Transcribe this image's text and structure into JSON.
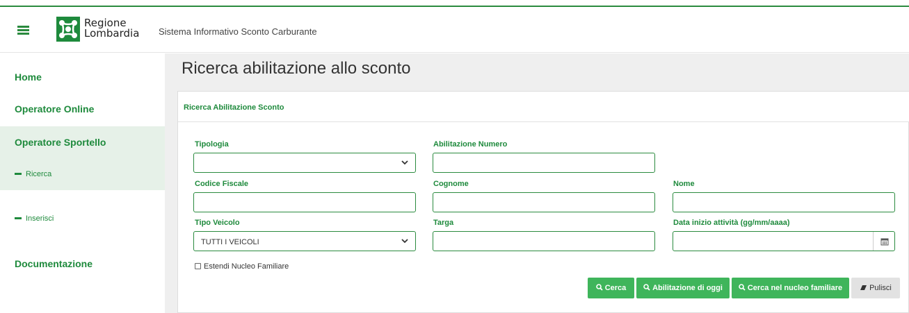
{
  "header": {
    "logo_line1": "Regione",
    "logo_line2": "Lombardia",
    "app_title": "Sistema Informativo Sconto Carburante"
  },
  "sidebar": {
    "home": "Home",
    "operatore_online": "Operatore Online",
    "operatore_sportello": "Operatore Sportello",
    "sub_ricerca": "Ricerca",
    "sub_inserisci": "Inserisci",
    "documentazione": "Documentazione"
  },
  "main": {
    "page_title": "Ricerca abilitazione allo sconto",
    "panel_title": "Ricerca Abilitazione Sconto",
    "form": {
      "tipologia_label": "Tipologia",
      "tipologia_value": "",
      "abilitazione_numero_label": "Abilitazione Numero",
      "abilitazione_numero_value": "",
      "codice_fiscale_label": "Codice Fiscale",
      "codice_fiscale_value": "",
      "cognome_label": "Cognome",
      "cognome_value": "",
      "nome_label": "Nome",
      "nome_value": "",
      "tipo_veicolo_label": "Tipo Veicolo",
      "tipo_veicolo_value": "TUTTI I VEICOLI",
      "targa_label": "Targa",
      "targa_value": "",
      "data_inizio_label": "Data inizio attività (gg/mm/aaaa)",
      "data_inizio_value": "",
      "estendi_label": "Estendi Nucleo Familiare",
      "estendi_checked": false
    },
    "buttons": {
      "cerca": "Cerca",
      "abilitazione_oggi": "Abilitazione di oggi",
      "cerca_nucleo": "Cerca nel nucleo familiare",
      "pulisci": "Pulisci"
    }
  },
  "colors": {
    "brand_green": "#1e8a3c",
    "button_green": "#3fb55b",
    "sidebar_active_bg": "#e6f1e8",
    "content_bg": "#efefef"
  },
  "icons": {
    "menu": "hamburger-icon",
    "logo": "regione-lombardia-logo",
    "select": "chevron-down-icon",
    "calendar": "calendar-icon",
    "search": "search-icon",
    "eraser": "eraser-icon"
  }
}
